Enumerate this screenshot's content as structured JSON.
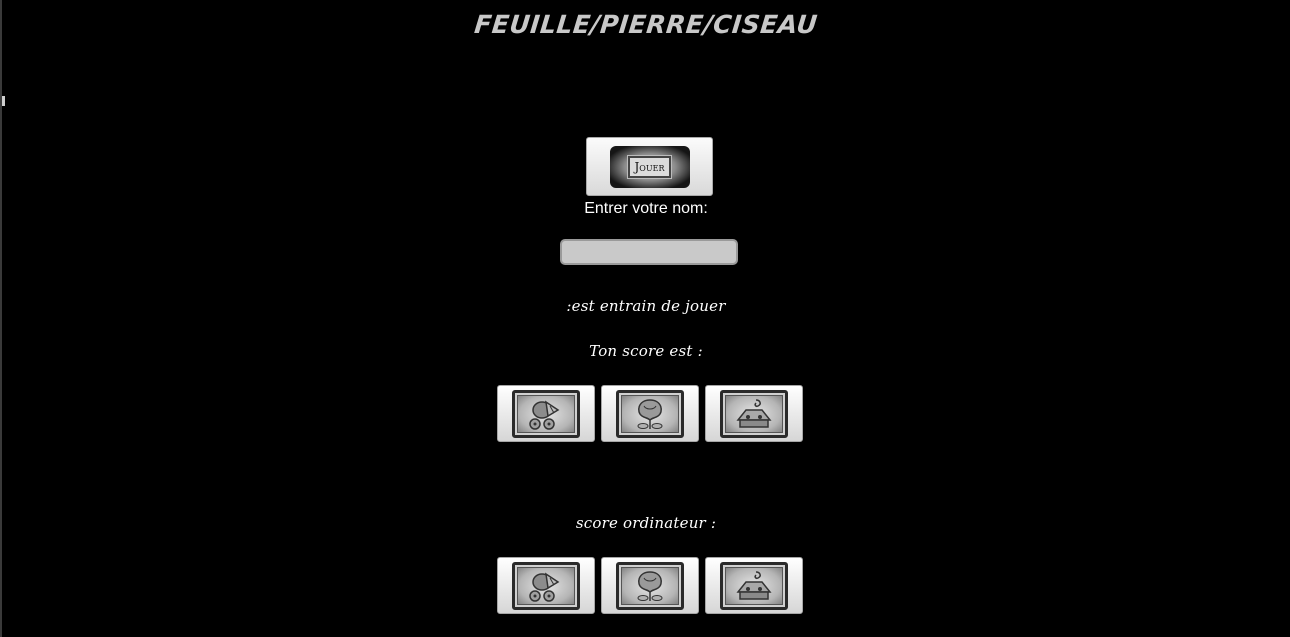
{
  "game": {
    "title": "FEUILLE/PIERRE/CISEAU"
  },
  "play_button": {
    "label": "Jouer"
  },
  "name_prompt": {
    "label": "Entrer votre nom:",
    "input_value": ""
  },
  "status": {
    "playing_text": ":est entrain de jouer",
    "player_score_text": "Ton score est :",
    "computer_score_text": "score ordinateur :"
  },
  "player_choices": [
    {
      "icon": "leaf-card-icon"
    },
    {
      "icon": "rock-card-icon"
    },
    {
      "icon": "scissors-card-icon"
    }
  ],
  "computer_choices": [
    {
      "icon": "leaf-card-icon"
    },
    {
      "icon": "rock-card-icon"
    },
    {
      "icon": "scissors-card-icon"
    }
  ],
  "colors": {
    "background": "#000000",
    "title": "#c8c8c8",
    "text": "#ffffff",
    "input_fill": "#c9c9c9"
  }
}
